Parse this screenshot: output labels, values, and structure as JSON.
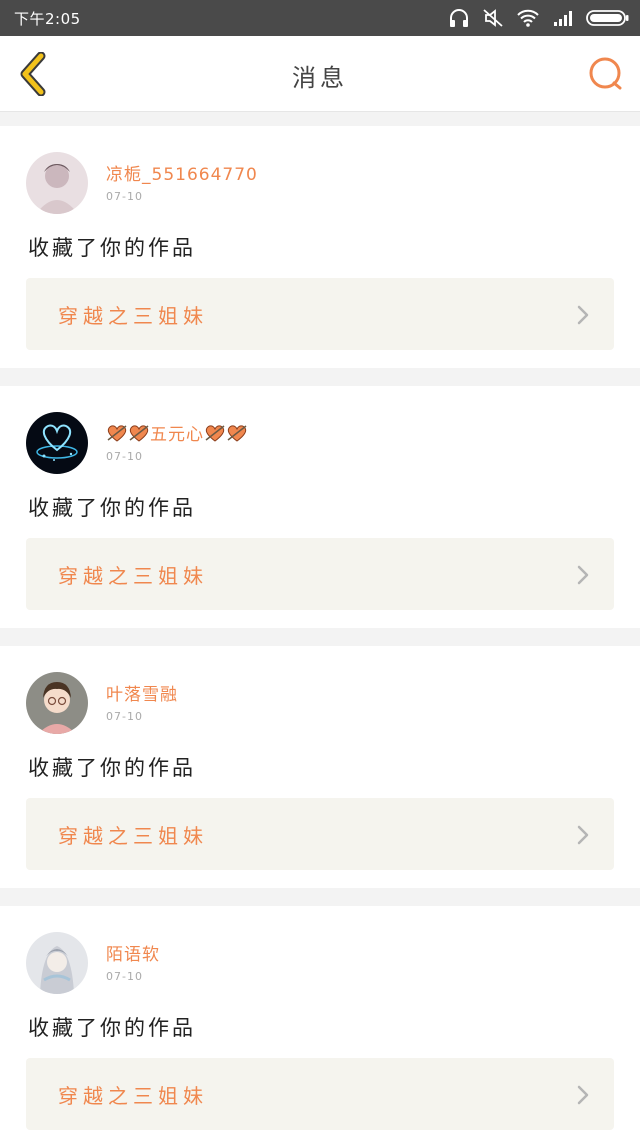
{
  "status_bar": {
    "time": "下午2:05",
    "icons": [
      "headphones-icon",
      "mute-icon",
      "wifi-icon",
      "signal-icon",
      "battery-icon"
    ]
  },
  "nav": {
    "title": "消息",
    "back_icon": "chevron-left-icon",
    "search_icon": "search-icon"
  },
  "colors": {
    "accent": "#f0874e",
    "back_icon": "#f2c21b",
    "card_link_bg": "#f5f4ee",
    "page_bg": "#f3f3f3"
  },
  "messages": [
    {
      "username": "凉栀_551664770",
      "date": "07-10",
      "action": "收藏了你的作品",
      "work_title": "穿越之三姐妹"
    },
    {
      "username_prefix_icons": [
        "heart-icon",
        "heart-icon"
      ],
      "username": "五元心",
      "username_suffix_icons": [
        "heart-icon",
        "heart-icon"
      ],
      "date": "07-10",
      "action": "收藏了你的作品",
      "work_title": "穿越之三姐妹"
    },
    {
      "username": "叶落雪融",
      "date": "07-10",
      "action": "收藏了你的作品",
      "work_title": "穿越之三姐妹"
    },
    {
      "username": "陌语软",
      "date": "07-10",
      "action": "收藏了你的作品",
      "work_title": "穿越之三姐妹"
    }
  ]
}
